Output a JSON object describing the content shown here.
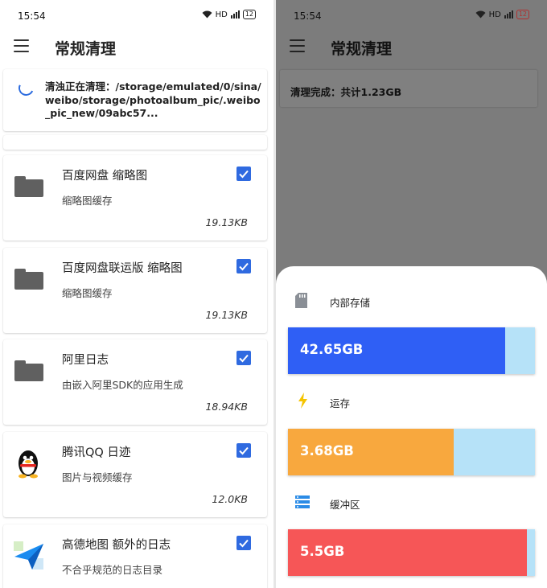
{
  "status_bar": {
    "time": "15:54",
    "network": "HD",
    "battery": "12"
  },
  "app": {
    "title": "常规清理"
  },
  "progress": {
    "label": "清浊正在清理：/storage/emulated/0/sina/weibo/storage/photoalbum_pic/.weibo_pic_new/09abc57..."
  },
  "items": [
    {
      "name": "百度网盘 缩略图",
      "desc": "缩略图缓存",
      "size": "19.13KB",
      "icon": "folder-icon",
      "checked": true
    },
    {
      "name": "百度网盘联运版 缩略图",
      "desc": "缩略图缓存",
      "size": "19.13KB",
      "icon": "folder-icon",
      "checked": true
    },
    {
      "name": "阿里日志",
      "desc": "由嵌入阿里SDK的应用生成",
      "size": "18.94KB",
      "icon": "folder-icon",
      "checked": true
    },
    {
      "name": "腾讯QQ 日迹",
      "desc": "图片与视频缓存",
      "size": "12.0KB",
      "icon": "qq-penguin-icon",
      "checked": true
    },
    {
      "name": "高德地图 额外的日志",
      "desc": "不合乎规范的日志目录",
      "size": "",
      "icon": "amap-icon",
      "checked": true
    }
  ],
  "result": {
    "done_label": "清理完成：共计1.23GB"
  },
  "storage_sheet": {
    "rows": [
      {
        "label": "内部存储",
        "icon": "sd-card-icon",
        "value": "42.65GB",
        "fraction": 0.878,
        "color": "#2f5ff5"
      },
      {
        "label": "运存",
        "icon": "lightning-icon",
        "value": "3.68GB",
        "fraction": 0.67,
        "color": "#f8a83e"
      },
      {
        "label": "缓冲区",
        "icon": "server-stack-icon",
        "value": "5.5GB",
        "fraction": 0.966,
        "color": "#f65657"
      }
    ]
  },
  "colors": {
    "checkbox": "#2f6ae0",
    "spinner": "#2d6cdf",
    "scrim": "#7c7c7c",
    "track": "#b6e2f8"
  }
}
